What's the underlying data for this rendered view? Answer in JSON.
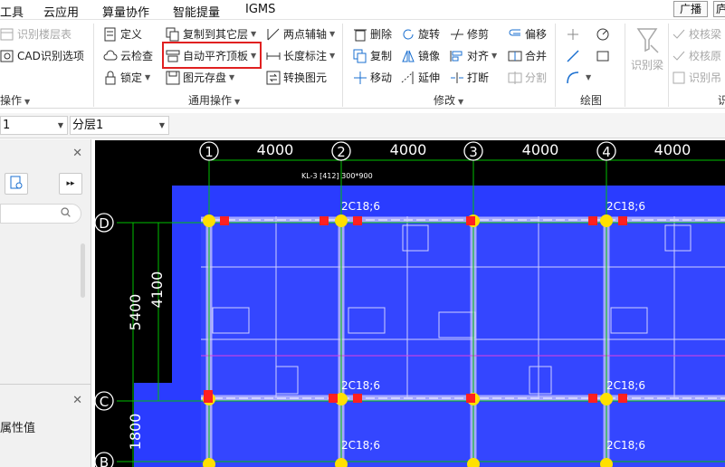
{
  "menu": {
    "items": [
      "工具",
      "云应用",
      "算量协作",
      "智能提量",
      "IGMS"
    ],
    "broadcast": "广播",
    "extra": "庐"
  },
  "ribbon": {
    "col0": [
      "识别楼层表",
      "CAD识别选项"
    ],
    "group0_label": "操作",
    "general": {
      "define": "定义",
      "cloud_check": "云检查",
      "lock": "锁定",
      "copy_to_other_floor": "复制到其它层",
      "auto_flat_top": "自动平齐顶板",
      "element_save": "图元存盘",
      "two_point_axis": "两点辅轴",
      "length_dim": "长度标注",
      "convert_element": "转换图元",
      "label": "通用操作"
    },
    "modify": {
      "delete": "删除",
      "copy": "复制",
      "move": "移动",
      "rotate": "旋转",
      "mirror": "镜像",
      "extend": "延伸",
      "trim": "修剪",
      "align": "对齐",
      "break": "打断",
      "offset": "偏移",
      "merge": "合并",
      "split": "分割",
      "label": "修改"
    },
    "draw": {
      "label": "绘图"
    },
    "recog": {
      "identify_beam": "识别梁",
      "verify_beam": "校核梁",
      "verify_origin": "校核原",
      "identify_hang": "识别吊",
      "partial": "识"
    }
  },
  "floorbar": {
    "left_value": "1",
    "floor_value": "分层1"
  },
  "leftpanel": {
    "property_label": "属性值"
  },
  "drawing": {
    "axes_top": [
      "1",
      "2",
      "3",
      "4"
    ],
    "axes_left": [
      "D",
      "C",
      "B"
    ],
    "dims_top": [
      "4000",
      "4000",
      "4000",
      "4000"
    ],
    "dims_left": [
      "5400",
      "4100",
      "1800"
    ],
    "beam_labels": [
      "2C18;6",
      "2C18;6",
      "2C18;6",
      "2C18;6",
      "2C18;6",
      "2C18;6"
    ],
    "beam_note": "KL-3 [412] 300*900"
  },
  "colors": {
    "highlight": "#e02020",
    "slab_blue": "#2a3cff",
    "axis_green": "#00c000",
    "canvas_bg": "#000000"
  },
  "icons": [
    "define-icon",
    "cloud-check-icon",
    "lock-icon",
    "copy-floor-icon",
    "flat-top-icon",
    "save-element-icon",
    "axis-icon",
    "dimension-icon",
    "convert-icon",
    "delete-icon",
    "copy-icon",
    "move-icon",
    "rotate-icon",
    "mirror-icon",
    "extend-icon",
    "trim-icon",
    "align-icon",
    "break-icon",
    "offset-icon",
    "merge-icon",
    "split-icon",
    "identify-beam-icon"
  ]
}
